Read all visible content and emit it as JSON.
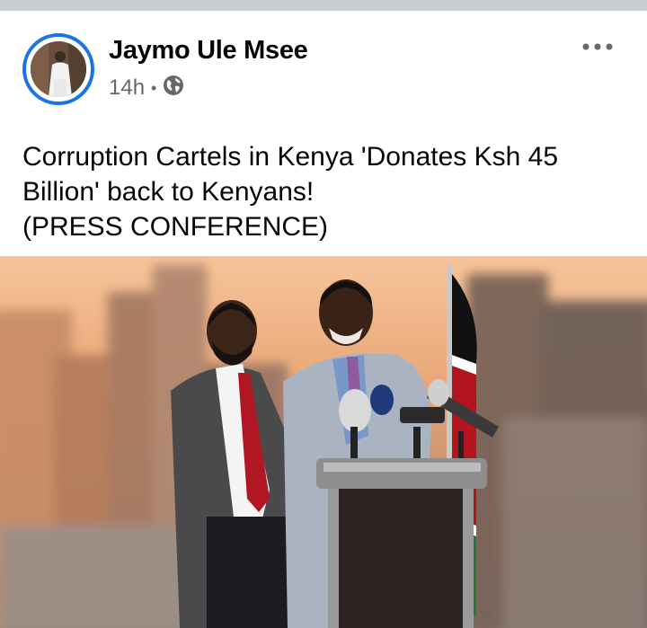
{
  "post": {
    "author": "Jaymo Ule Msee",
    "time": "14h",
    "separator": "•",
    "audience_icon": "globe-icon",
    "more_icon": "more-horizontal-icon",
    "text_lines": [
      "Corruption Cartels in Kenya 'Donates Ksh 45",
      "Billion' back to Kenyans!",
      "(PRESS CONFERENCE)"
    ]
  },
  "colors": {
    "avatar_ring": "#1b74e4",
    "name": "#050505",
    "meta": "#65676b",
    "page_background": "#c9ccd1"
  }
}
